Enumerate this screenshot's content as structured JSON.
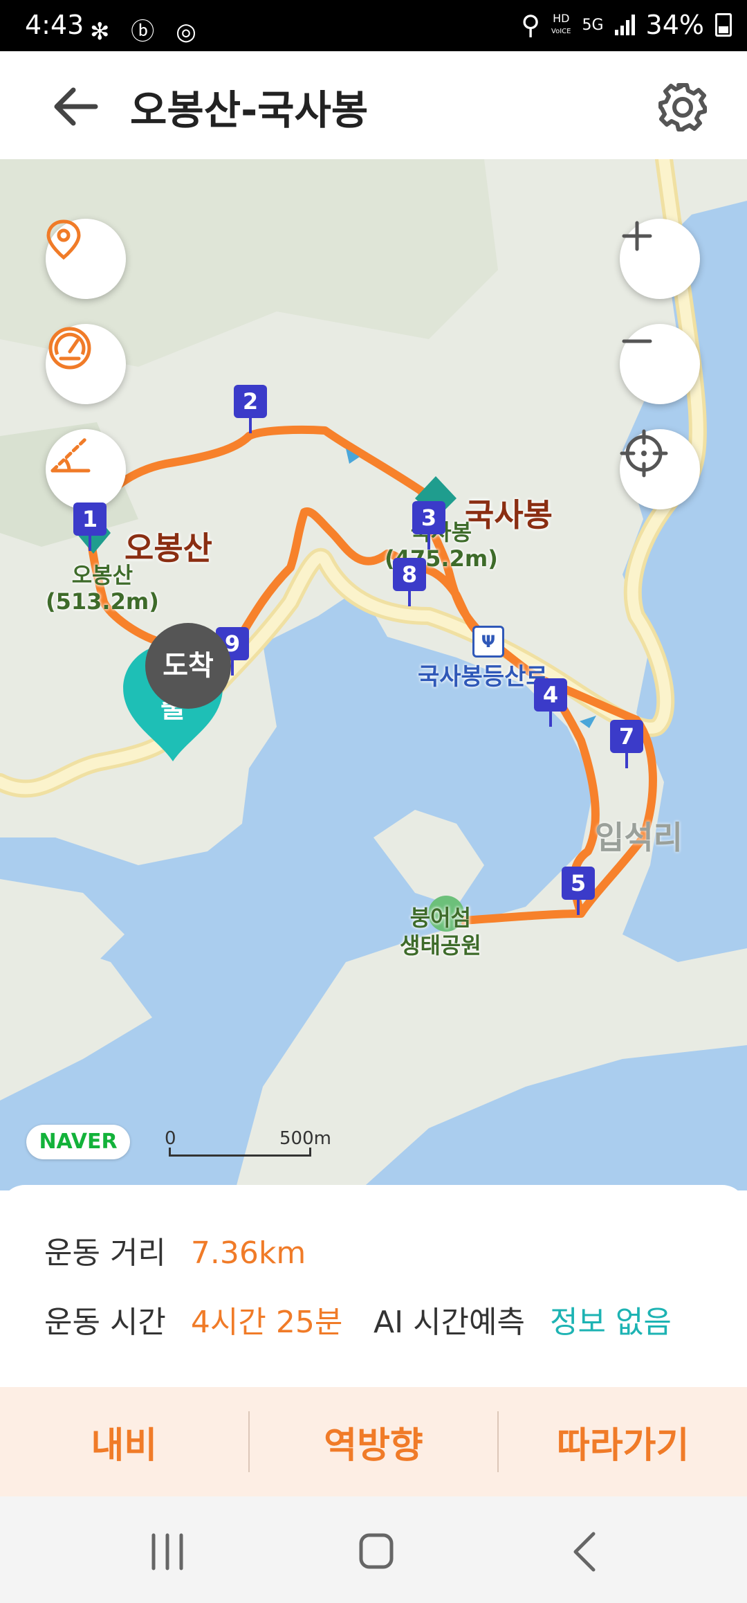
{
  "status": {
    "time": "4:43",
    "battery": "34%",
    "network": "5G",
    "hd_label": "HD",
    "voice_label": "VoICE"
  },
  "header": {
    "title": "오봉산-국사봉",
    "back_icon": "arrow-left-icon",
    "settings_icon": "gear-icon"
  },
  "map": {
    "controls_left": [
      "location-pin-icon",
      "speedometer-icon",
      "slope-icon"
    ],
    "controls_right": [
      "zoom-in-icon",
      "zoom-out-icon",
      "crosshair-icon"
    ],
    "peaks": [
      {
        "name": "오봉산",
        "sub1": "오봉산",
        "sub2": "(513.2m)"
      },
      {
        "name": "국사봉",
        "sub1": "국사봉",
        "sub2": "(475.2m)"
      }
    ],
    "places": {
      "restaurant": "국사봉등산로",
      "village": "입석리",
      "park_line1": "붕어섬",
      "park_line2": "생태공원"
    },
    "waypoints": [
      "1",
      "2",
      "3",
      "4",
      "5",
      "7",
      "8",
      "9"
    ],
    "arrive_label": "도착",
    "start_label": "출",
    "brand": "NAVER",
    "scale": {
      "start": "0",
      "end": "500m"
    }
  },
  "summary": {
    "distance_label": "운동 거리",
    "distance_value": "7.36km",
    "time_label": "운동 시간",
    "time_value": "4시간 25분",
    "ai_label": "AI 시간예측",
    "ai_value": "정보 없음"
  },
  "actions": [
    "내비",
    "역방향",
    "따라가기"
  ],
  "colors": {
    "accent": "#f07b28",
    "teal": "#1db3b3",
    "route": "#f7812b",
    "waypoint": "#3b3bc9"
  }
}
